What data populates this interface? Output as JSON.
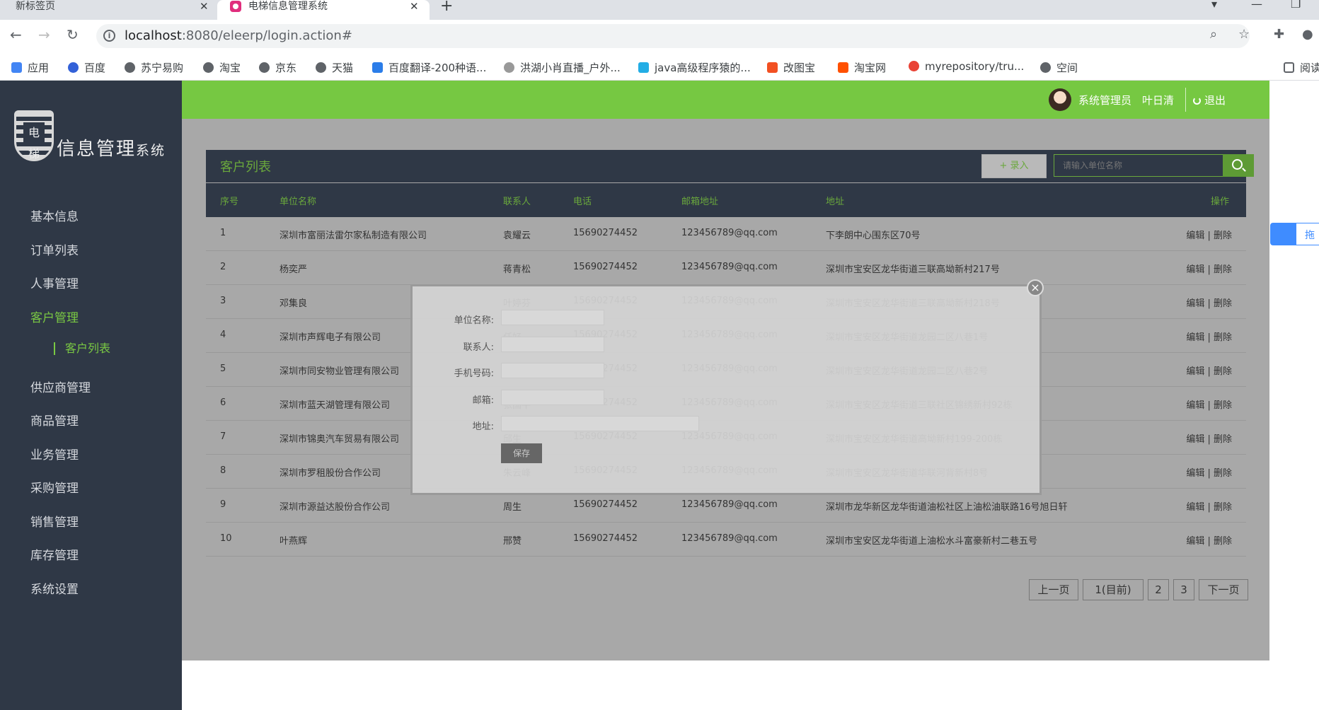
{
  "browser": {
    "tabs": [
      {
        "label": "新标签页",
        "close": "✕"
      },
      {
        "label": "电梯信息管理系统",
        "close": "✕"
      }
    ],
    "new_tab": "+",
    "address": {
      "host": "localhost",
      "path": ":8080/eleerp/login.action#"
    },
    "bookmarks": [
      "应用",
      "百度",
      "苏宁易购",
      "淘宝",
      "京东",
      "天猫",
      "百度翻译-200种语...",
      "洪湖小肖直播_户外...",
      "java高级程序猿的...",
      "改图宝",
      "淘宝网",
      "myrepository/tru...",
      "空间",
      "阅读"
    ]
  },
  "sidebar": {
    "logo_mark": "电梯",
    "logo_title": "信息管理",
    "logo_suffix": "系统",
    "menu": [
      "基本信息",
      "订单列表",
      "人事管理",
      "客户管理",
      "供应商管理",
      "商品管理",
      "业务管理",
      "采购管理",
      "销售管理",
      "库存管理",
      "系统设置"
    ],
    "submenu": [
      "客户列表"
    ]
  },
  "topbar": {
    "role": "系统管理员",
    "username": "叶日清",
    "logout": "退出"
  },
  "panel": {
    "title": "客户列表",
    "add_label": "+ 录入",
    "search_placeholder": "请输入单位名称"
  },
  "table": {
    "headers": [
      "序号",
      "单位名称",
      "联系人",
      "电话",
      "邮箱地址",
      "地址",
      "操作"
    ],
    "rows": [
      [
        "1",
        "深圳市富丽法雷尔家私制造有限公司",
        "袁耀云",
        "15690274452",
        "123456789@qq.com",
        "下李朗中心围东区70号"
      ],
      [
        "2",
        "杨奕严",
        "蒋青松",
        "15690274452",
        "123456789@qq.com",
        "深圳市宝安区龙华街道三联高坳新村217号"
      ],
      [
        "3",
        "邓集良",
        "叶婷芬",
        "15690274452",
        "123456789@qq.com",
        "深圳市宝安区龙华街道三联高坳新村218号"
      ],
      [
        "4",
        "深圳市声辉电子有限公司",
        "任好",
        "15690274452",
        "123456789@qq.com",
        "深圳市宝安区龙华街道龙园二区八巷1号"
      ],
      [
        "5",
        "深圳市同安物业管理有限公司",
        "王辉",
        "15690274452",
        "123456789@qq.com",
        "深圳市宝安区龙华街道龙园二区八巷2号"
      ],
      [
        "6",
        "深圳市蓝天湖管理有限公司",
        "张国平",
        "15690274452",
        "123456789@qq.com",
        "深圳市宝安区龙华街道三联社区锦绣新村92栋"
      ],
      [
        "7",
        "深圳市锦奥汽车贸易有限公司",
        "邱生",
        "15690274452",
        "123456789@qq.com",
        "深圳市宝安区龙华街道高坳新村199-200栋"
      ],
      [
        "8",
        "深圳市罗租股份合作公司",
        "朱云峰",
        "15690274452",
        "123456789@qq.com",
        "深圳市宝安区龙华街道华联河背新村8号"
      ],
      [
        "9",
        "深圳市源益达股份合作公司",
        "周生",
        "15690274452",
        "123456789@qq.com",
        "深圳市龙华新区龙华街道油松社区上油松油联路16号旭日轩"
      ],
      [
        "10",
        "叶燕辉",
        "邢赞",
        "15690274452",
        "123456789@qq.com",
        "深圳市宝安区龙华街道上油松水斗富豪新村二巷五号"
      ]
    ],
    "ops_label": "编辑 | 删除"
  },
  "pagination": {
    "prev": "上一页",
    "current": "1(目前)",
    "pages": [
      "2",
      "3"
    ],
    "next": "下一页"
  },
  "modal": {
    "labels": [
      "单位名称:",
      "联系人:",
      "手机号码:",
      "邮箱:",
      "地址:"
    ],
    "save": "保存",
    "close": "×"
  },
  "side_widget": "拖"
}
